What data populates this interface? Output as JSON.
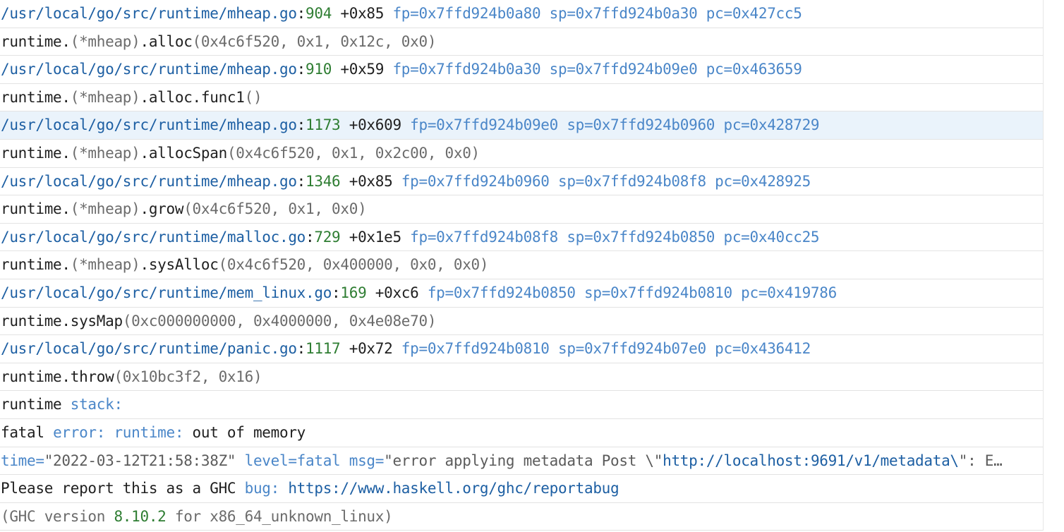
{
  "colors": {
    "path": "#1d5fa3",
    "number": "#2e7d32",
    "keyword": "#4a86c8",
    "muted": "#6b6b6b",
    "text": "#1f1f1f",
    "highlight_bg": "#eaf3fb"
  },
  "log_lines": [
    {
      "highlight": false,
      "tokens": [
        {
          "t": "/usr/local/go/src/runtime/mheap.go",
          "c": "path"
        },
        {
          "t": ":",
          "c": "text"
        },
        {
          "t": "904",
          "c": "num"
        },
        {
          "t": " +0x85 ",
          "c": "text"
        },
        {
          "t": "fp=0x7ffd924b0a80 sp=0x7ffd924b0a30 pc=0x427cc5",
          "c": "kw"
        }
      ]
    },
    {
      "highlight": false,
      "tokens": [
        {
          "t": "runtime.",
          "c": "text"
        },
        {
          "t": "(*mheap)",
          "c": "muted"
        },
        {
          "t": ".alloc",
          "c": "text"
        },
        {
          "t": "(0x4c6f520, 0x1, 0x12c, 0x0)",
          "c": "muted"
        }
      ]
    },
    {
      "highlight": false,
      "tokens": [
        {
          "t": "/usr/local/go/src/runtime/mheap.go",
          "c": "path"
        },
        {
          "t": ":",
          "c": "text"
        },
        {
          "t": "910",
          "c": "num"
        },
        {
          "t": " +0x59 ",
          "c": "text"
        },
        {
          "t": "fp=0x7ffd924b0a30 sp=0x7ffd924b09e0 pc=0x463659",
          "c": "kw"
        }
      ]
    },
    {
      "highlight": false,
      "tokens": [
        {
          "t": "runtime.",
          "c": "text"
        },
        {
          "t": "(*mheap)",
          "c": "muted"
        },
        {
          "t": ".alloc.func1",
          "c": "text"
        },
        {
          "t": "()",
          "c": "muted"
        }
      ]
    },
    {
      "highlight": true,
      "tokens": [
        {
          "t": "/usr/local/go/src/runtime/mheap.go",
          "c": "path"
        },
        {
          "t": ":",
          "c": "text"
        },
        {
          "t": "1173",
          "c": "num"
        },
        {
          "t": " +0x609 ",
          "c": "text"
        },
        {
          "t": "fp=0x7ffd924b09e0 sp=0x7ffd924b0960 pc=0x428729",
          "c": "kw"
        }
      ]
    },
    {
      "highlight": false,
      "tokens": [
        {
          "t": "runtime.",
          "c": "text"
        },
        {
          "t": "(*mheap)",
          "c": "muted"
        },
        {
          "t": ".allocSpan",
          "c": "text"
        },
        {
          "t": "(0x4c6f520, 0x1, 0x2c00, 0x0)",
          "c": "muted"
        }
      ]
    },
    {
      "highlight": false,
      "tokens": [
        {
          "t": "/usr/local/go/src/runtime/mheap.go",
          "c": "path"
        },
        {
          "t": ":",
          "c": "text"
        },
        {
          "t": "1346",
          "c": "num"
        },
        {
          "t": " +0x85 ",
          "c": "text"
        },
        {
          "t": "fp=0x7ffd924b0960 sp=0x7ffd924b08f8 pc=0x428925",
          "c": "kw"
        }
      ]
    },
    {
      "highlight": false,
      "tokens": [
        {
          "t": "runtime.",
          "c": "text"
        },
        {
          "t": "(*mheap)",
          "c": "muted"
        },
        {
          "t": ".grow",
          "c": "text"
        },
        {
          "t": "(0x4c6f520, 0x1, 0x0)",
          "c": "muted"
        }
      ]
    },
    {
      "highlight": false,
      "tokens": [
        {
          "t": "/usr/local/go/src/runtime/malloc.go",
          "c": "path"
        },
        {
          "t": ":",
          "c": "text"
        },
        {
          "t": "729",
          "c": "num"
        },
        {
          "t": " +0x1e5 ",
          "c": "text"
        },
        {
          "t": "fp=0x7ffd924b08f8 sp=0x7ffd924b0850 pc=0x40cc25",
          "c": "kw"
        }
      ]
    },
    {
      "highlight": false,
      "tokens": [
        {
          "t": "runtime.",
          "c": "text"
        },
        {
          "t": "(*mheap)",
          "c": "muted"
        },
        {
          "t": ".sysAlloc",
          "c": "text"
        },
        {
          "t": "(0x4c6f520, 0x400000, 0x0, 0x0)",
          "c": "muted"
        }
      ]
    },
    {
      "highlight": false,
      "tokens": [
        {
          "t": "/usr/local/go/src/runtime/mem_linux.go",
          "c": "path"
        },
        {
          "t": ":",
          "c": "text"
        },
        {
          "t": "169",
          "c": "num"
        },
        {
          "t": " +0xc6 ",
          "c": "text"
        },
        {
          "t": "fp=0x7ffd924b0850 sp=0x7ffd924b0810 pc=0x419786",
          "c": "kw"
        }
      ]
    },
    {
      "highlight": false,
      "tokens": [
        {
          "t": "runtime.sysMap",
          "c": "text"
        },
        {
          "t": "(0xc000000000, 0x4000000, 0x4e08e70)",
          "c": "muted"
        }
      ]
    },
    {
      "highlight": false,
      "tokens": [
        {
          "t": "/usr/local/go/src/runtime/panic.go",
          "c": "path"
        },
        {
          "t": ":",
          "c": "text"
        },
        {
          "t": "1117",
          "c": "num"
        },
        {
          "t": " +0x72 ",
          "c": "text"
        },
        {
          "t": "fp=0x7ffd924b0810 sp=0x7ffd924b07e0 pc=0x436412",
          "c": "kw"
        }
      ]
    },
    {
      "highlight": false,
      "tokens": [
        {
          "t": "runtime.throw",
          "c": "text"
        },
        {
          "t": "(0x10bc3f2, 0x16)",
          "c": "muted"
        }
      ]
    },
    {
      "highlight": false,
      "tokens": [
        {
          "t": "runtime ",
          "c": "text"
        },
        {
          "t": "stack:",
          "c": "kw"
        }
      ]
    },
    {
      "highlight": false,
      "tokens": [
        {
          "t": "fatal ",
          "c": "text"
        },
        {
          "t": "error:",
          "c": "kw"
        },
        {
          "t": " ",
          "c": "text"
        },
        {
          "t": "runtime:",
          "c": "kw"
        },
        {
          "t": " out of memory",
          "c": "text"
        }
      ]
    },
    {
      "highlight": false,
      "tokens": [
        {
          "t": "time=",
          "c": "kw"
        },
        {
          "t": "\"2022-03-12T21:58:38Z\"",
          "c": "str"
        },
        {
          "t": " ",
          "c": "text"
        },
        {
          "t": "level=fatal",
          "c": "kw"
        },
        {
          "t": " ",
          "c": "text"
        },
        {
          "t": "msg=",
          "c": "kw"
        },
        {
          "t": "\"error applying metadata Post \\\"",
          "c": "str"
        },
        {
          "t": "http://localhost:9691/v1/metadata\\",
          "c": "url"
        },
        {
          "t": "\": E…",
          "c": "str"
        }
      ]
    },
    {
      "highlight": false,
      "tokens": [
        {
          "t": "Please report this as a GHC ",
          "c": "text"
        },
        {
          "t": "bug:",
          "c": "kw"
        },
        {
          "t": " ",
          "c": "text"
        },
        {
          "t": "https://www.haskell.org/ghc/reportabug",
          "c": "url"
        }
      ]
    },
    {
      "highlight": false,
      "tokens": [
        {
          "t": "(GHC version ",
          "c": "muted"
        },
        {
          "t": "8.10.2",
          "c": "num"
        },
        {
          "t": " for x86_64_unknown_linux)",
          "c": "muted"
        }
      ]
    }
  ]
}
